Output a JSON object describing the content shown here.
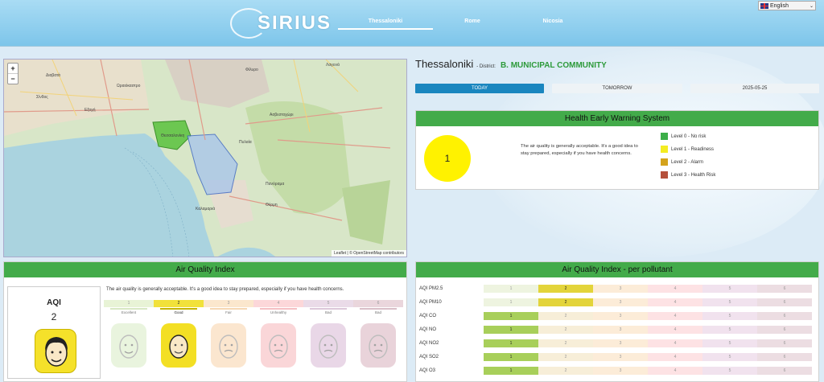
{
  "header": {
    "logo_text": "SIRIUS",
    "nav": [
      "Thessaloniki",
      "Rome",
      "Nicosia"
    ],
    "active_nav": "Thessaloniki",
    "language": "English"
  },
  "map": {
    "zoom_in": "+",
    "zoom_out": "−",
    "attribution": "Leaflet | © OpenStreetMap contributors",
    "labels": [
      "Διαβατά",
      "Σίνδος",
      "Θεσσαλονίκη",
      "Πυλαία",
      "Θέρμη",
      "Πανόραμα",
      "Καλαμαριά",
      "Ασβεστοχώρι",
      "Φίλυρο",
      "Λαγυνά",
      "Ωραιόκαστρο",
      "Εξοχή"
    ]
  },
  "city": {
    "name": "Thessaloniki",
    "district_label": "- District:",
    "district": "B. MUNICIPAL COMMUNITY"
  },
  "tabs": [
    "TODAY",
    "TOMORROW",
    "2025-05-25"
  ],
  "hews": {
    "title": "Health Early Warning System",
    "level": "1",
    "message": "The air quality is generally acceptable. It's a good idea to stay prepared, especially if you have health concerns.",
    "legend": [
      {
        "label": "Level 0 - No risk",
        "color": "#3cae49"
      },
      {
        "label": "Level 1 - Readiness",
        "color": "#f4ec22"
      },
      {
        "label": "Level 2 - Alarm",
        "color": "#d4a31c"
      },
      {
        "label": "Level 3 - Health Risk",
        "color": "#b5503b"
      }
    ]
  },
  "aqi": {
    "title": "Air Quality Index",
    "label": "AQI",
    "value": "2",
    "message": "The air quality is generally acceptable. It's a good idea to stay prepared, especially if you have health concerns.",
    "scale": [
      {
        "n": "1",
        "label": "Excellent",
        "color": "#e8f3d6",
        "line": "#d8e8c4",
        "face": "#d8ecc4"
      },
      {
        "n": "2",
        "label": "Good",
        "color": "#f1e13a",
        "line": "#c6b500",
        "face": "#f3df24"
      },
      {
        "n": "3",
        "label": "Fair",
        "color": "#fbe7cd",
        "line": "#f6d8b4",
        "face": "#f9d2a8"
      },
      {
        "n": "4",
        "label": "Unhealthy",
        "color": "#fcd7d9",
        "line": "#f5c0c4",
        "face": "#f7b5ba"
      },
      {
        "n": "5",
        "label": "Bad",
        "color": "#eadbe8",
        "line": "#dcc8da",
        "face": "#d8b8d4"
      },
      {
        "n": "6",
        "label": "Bad",
        "color": "#ead6dc",
        "line": "#d9bfc8",
        "face": "#d8b0bc"
      }
    ]
  },
  "pollutants": {
    "title": "Air Quality Index - per pollutant",
    "rows": [
      {
        "name": "AQI PM2.5",
        "level": 2
      },
      {
        "name": "AQI PM10",
        "level": 2
      },
      {
        "name": "AQI CO",
        "level": 1
      },
      {
        "name": "AQI NO",
        "level": 1
      },
      {
        "name": "AQI NO2",
        "level": 1
      },
      {
        "name": "AQI SO2",
        "level": 1
      },
      {
        "name": "AQI O3",
        "level": 1
      }
    ],
    "cell_colors": [
      "#eef4e0",
      "#f7eed8",
      "#fcecd8",
      "#fde2e4",
      "#f1e2ee",
      "#ecdde2"
    ],
    "active_colors": {
      "1": "#a8cf5a",
      "2": "#e3d43a"
    },
    "cell_labels": [
      "1",
      "2",
      "3",
      "4",
      "5",
      "6"
    ]
  }
}
